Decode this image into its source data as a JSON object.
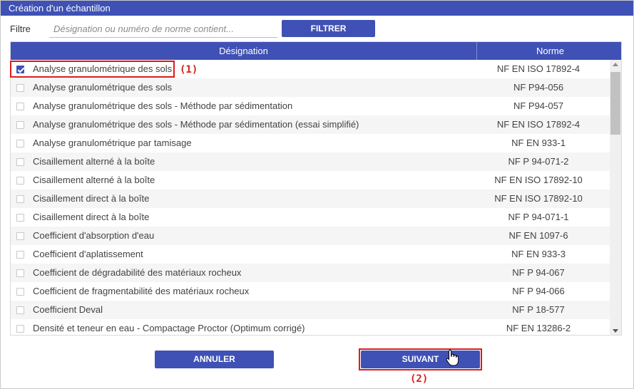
{
  "window": {
    "title": "Création d'un échantillon"
  },
  "filter": {
    "label": "Filtre",
    "placeholder": "Désignation ou numéro de norme contient...",
    "value": "",
    "button_label": "FILTRER"
  },
  "grid": {
    "columns": {
      "designation": "Désignation",
      "norme": "Norme"
    },
    "rows": [
      {
        "designation": "Analyse granulométrique des sols",
        "norme": "NF EN ISO 17892-4",
        "checked": true
      },
      {
        "designation": "Analyse granulométrique des sols",
        "norme": "NF P94-056",
        "checked": false
      },
      {
        "designation": "Analyse granulométrique des sols - Méthode par sédimentation",
        "norme": "NF P94-057",
        "checked": false
      },
      {
        "designation": "Analyse granulométrique des sols - Méthode par sédimentation (essai simplifié)",
        "norme": "NF EN ISO 17892-4",
        "checked": false
      },
      {
        "designation": "Analyse granulométrique par tamisage",
        "norme": "NF EN 933-1",
        "checked": false
      },
      {
        "designation": "Cisaillement alterné à la boîte",
        "norme": "NF P 94-071-2",
        "checked": false
      },
      {
        "designation": "Cisaillement alterné à la boîte",
        "norme": "NF EN ISO 17892-10",
        "checked": false
      },
      {
        "designation": "Cisaillement direct à la boîte",
        "norme": "NF EN ISO 17892-10",
        "checked": false
      },
      {
        "designation": "Cisaillement direct à la boîte",
        "norme": "NF P 94-071-1",
        "checked": false
      },
      {
        "designation": "Coefficient d'absorption d'eau",
        "norme": "NF EN 1097-6",
        "checked": false
      },
      {
        "designation": "Coefficient d'aplatissement",
        "norme": "NF EN 933-3",
        "checked": false
      },
      {
        "designation": "Coefficient de dégradabilité des matériaux rocheux",
        "norme": "NF P 94-067",
        "checked": false
      },
      {
        "designation": "Coefficient de fragmentabilité des matériaux rocheux",
        "norme": "NF P 94-066",
        "checked": false
      },
      {
        "designation": "Coefficient Deval",
        "norme": "NF P 18-577",
        "checked": false
      },
      {
        "designation": "Densité et teneur en eau - Compactage Proctor (Optimum corrigé)",
        "norme": "NF EN 13286-2",
        "checked": false
      }
    ]
  },
  "footer": {
    "cancel_label": "ANNULER",
    "next_label": "SUIVANT"
  },
  "annotations": {
    "first": "(1)",
    "second": "(2)"
  },
  "colors": {
    "accent": "#3f51b5",
    "highlight": "#e21a1a"
  }
}
